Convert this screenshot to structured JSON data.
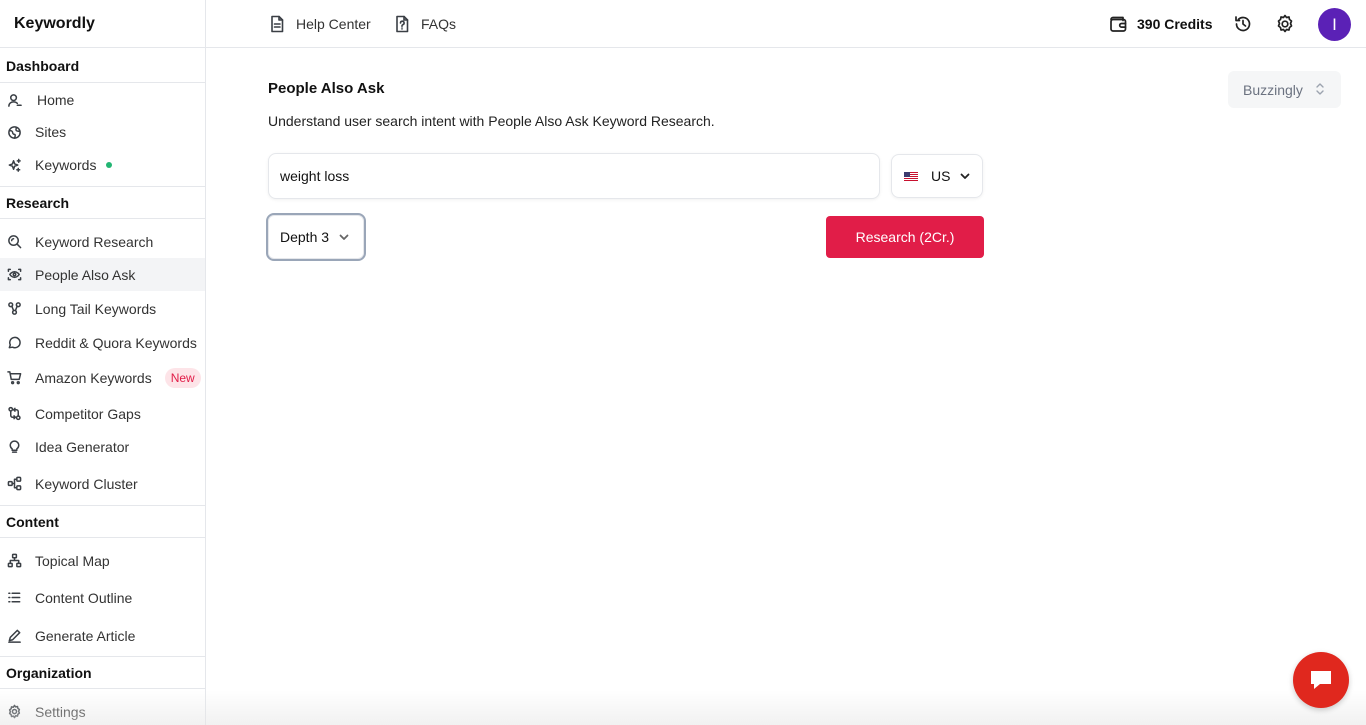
{
  "app": {
    "name": "Keywordly"
  },
  "sidebar": {
    "sections": {
      "dashboard": "Dashboard",
      "research": "Research",
      "content": "Content",
      "organization": "Organization"
    },
    "items": {
      "home": "Home",
      "sites": "Sites",
      "keywords": "Keywords",
      "keyword_research": "Keyword Research",
      "people_also_ask": "People Also Ask",
      "long_tail": "Long Tail Keywords",
      "reddit_quora": "Reddit & Quora Keywords",
      "amazon": "Amazon Keywords",
      "amazon_badge": "New",
      "competitor_gaps": "Competitor Gaps",
      "idea_generator": "Idea Generator",
      "keyword_cluster": "Keyword Cluster",
      "topical_map": "Topical Map",
      "content_outline": "Content Outline",
      "generate_article": "Generate Article",
      "settings": "Settings"
    },
    "active": "people_also_ask"
  },
  "topbar": {
    "help_center": "Help Center",
    "faqs": "FAQs",
    "credits": "390 Credits",
    "avatar_initial": "I"
  },
  "main": {
    "title": "People Also Ask",
    "subtitle": "Understand user search intent with People Also Ask Keyword Research.",
    "org_select": "Buzzingly",
    "search_value": "weight loss",
    "country": "US",
    "depth": "Depth 3",
    "research_button": "Research (2Cr.)"
  },
  "colors": {
    "accent": "#e11d48",
    "avatar": "#5b21b6",
    "status_dot": "#22b573",
    "chat": "#e0281e"
  }
}
